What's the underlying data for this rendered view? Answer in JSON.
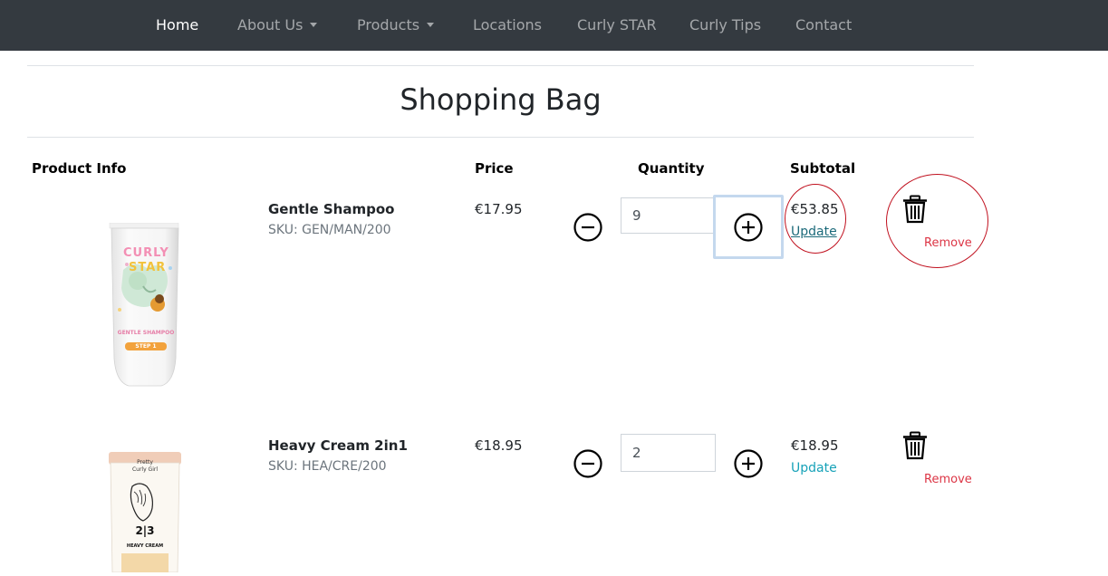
{
  "nav": {
    "items": [
      {
        "label": "Home",
        "active": true,
        "dropdown": false
      },
      {
        "label": "About Us",
        "active": false,
        "dropdown": true
      },
      {
        "label": "Products",
        "active": false,
        "dropdown": true
      },
      {
        "label": "Locations",
        "active": false,
        "dropdown": false
      },
      {
        "label": "Curly STAR",
        "active": false,
        "dropdown": false
      },
      {
        "label": "Curly Tips",
        "active": false,
        "dropdown": false
      },
      {
        "label": "Contact",
        "active": false,
        "dropdown": false
      }
    ]
  },
  "page": {
    "title": "Shopping Bag"
  },
  "table": {
    "headers": {
      "product_info": "Product Info",
      "price": "Price",
      "quantity": "Quantity",
      "subtotal": "Subtotal"
    }
  },
  "items": [
    {
      "name": "Gentle Shampoo",
      "sku": "SKU: GEN/MAN/200",
      "price": "€17.95",
      "quantity": "9",
      "subtotal": "€53.85",
      "update_label": "Update",
      "remove_label": "Remove",
      "image": {
        "brand_line1": "CURLY",
        "brand_line2": "STAR",
        "product_line": "GENTLE SHAMPOO",
        "step_label": "STEP 1"
      }
    },
    {
      "name": "Heavy Cream 2in1",
      "sku": "SKU: HEA/CRE/200",
      "price": "€18.95",
      "quantity": "2",
      "subtotal": "€18.95",
      "update_label": "Update",
      "remove_label": "Remove",
      "image": {
        "brand_line1": "Pretty",
        "brand_line2": "Curly Girl",
        "step_label": "2|3",
        "product_line": "HEAVY CREAM"
      }
    }
  ],
  "colors": {
    "navbar_bg": "#343a40",
    "update_link": "#17a2b8",
    "remove_link": "#dc3545",
    "annotation_circle": "#c0101e"
  }
}
